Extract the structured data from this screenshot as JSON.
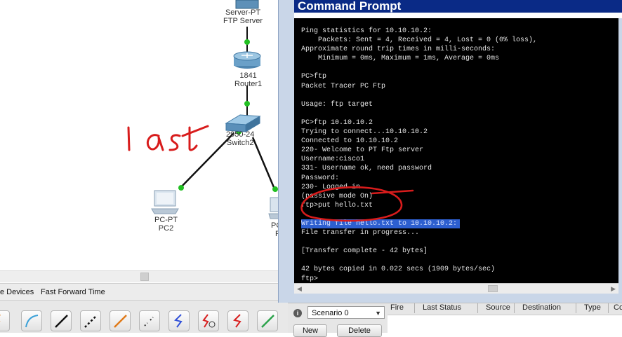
{
  "topology": {
    "server": {
      "line1": "Server-PT",
      "line2": "FTP Server"
    },
    "router": {
      "line1": "1841",
      "line2": "Router1"
    },
    "switch": {
      "line1": "2950-24",
      "line2": "Switch2"
    },
    "pc2": {
      "line1": "PC-PT",
      "line2": "PC2"
    },
    "pc_partial": {
      "line1": "PC",
      "line2": "P"
    },
    "annotation": "last"
  },
  "statusbar": {
    "devices_label": "e Devices",
    "fast_forward_label": "Fast Forward Time"
  },
  "cmd": {
    "title": "Command Prompt",
    "lines": [
      "Ping statistics for 10.10.10.2:",
      "    Packets: Sent = 4, Received = 4, Lost = 0 (0% loss),",
      "Approximate round trip times in milli-seconds:",
      "    Minimum = 0ms, Maximum = 1ms, Average = 0ms",
      "",
      "PC>ftp",
      "Packet Tracer PC Ftp",
      "",
      "Usage: ftp target",
      "",
      "PC>ftp 10.10.10.2",
      "Trying to connect...10.10.10.2",
      "Connected to 10.10.10.2",
      "220- Welcome to PT Ftp server",
      "Username:cisco1",
      "331- Username ok, need password",
      "Password:",
      "230- Logged in",
      "(passive mode On)",
      "ftp>put hello.txt",
      "",
      "Writing file hello.txt to 10.10.10.2:",
      "File transfer in progress...",
      "",
      "[Transfer complete - 42 bytes]",
      "",
      "42 bytes copied in 0.022 secs (1909 bytes/sec)",
      "ftp>"
    ],
    "highlighted_line_index": 21
  },
  "pdu_panel": {
    "info_icon": "i",
    "scenario_value": "Scenario 0",
    "new_button": "New",
    "delete_button": "Delete",
    "columns": [
      "Fire",
      "Last Status",
      "Source",
      "Destination",
      "Type",
      "Co"
    ]
  },
  "toolbar": {
    "icons": [
      "console-cable-icon",
      "straight-through-cable-icon",
      "crossover-cable-icon",
      "fiber-cable-icon",
      "phone-cable-icon",
      "coaxial-cable-icon",
      "serial-dce-icon",
      "serial-dte-icon",
      "octal-cable-icon",
      "auto-cable-icon"
    ]
  },
  "colors": {
    "title_bar": "#0a2a86",
    "terminal_bg": "#000000",
    "selection": "#2d5fd0",
    "wire": "#111111",
    "link_light": "#22c022",
    "ink": "#d81c1c"
  }
}
